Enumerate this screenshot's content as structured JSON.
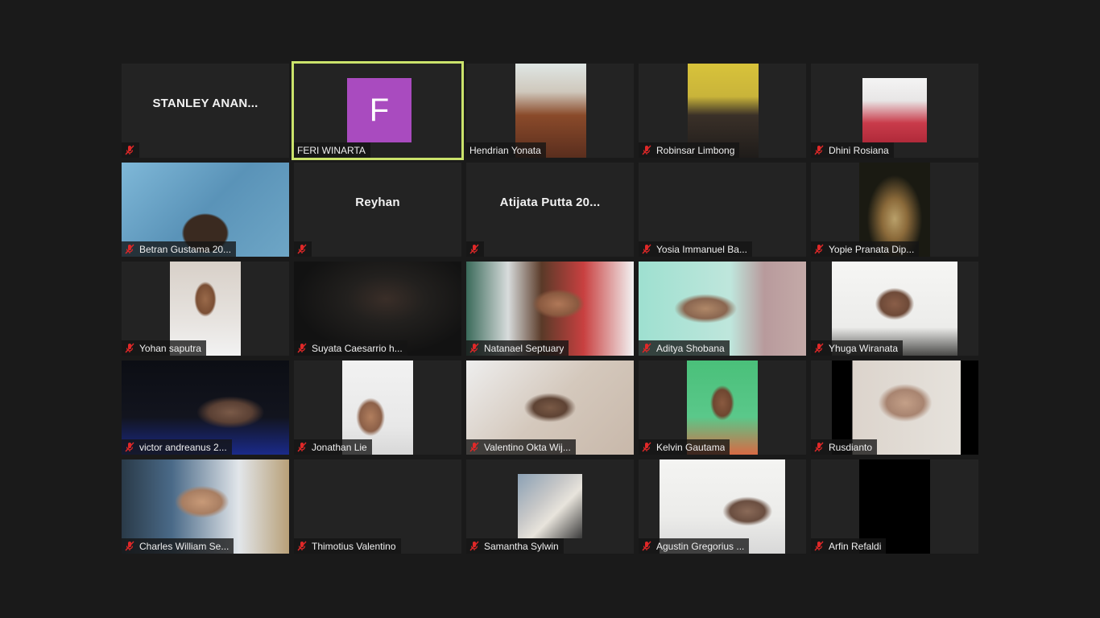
{
  "app": {
    "view": "gallery"
  },
  "participants": [
    {
      "name": "STANLEY ANAN...",
      "label": "",
      "muted": true,
      "type": "name",
      "active": false
    },
    {
      "name": "FERI WINARTA",
      "label": "FERI WINARTA",
      "muted": false,
      "type": "avatar",
      "avatar_letter": "F",
      "avatar_color": "#a94bbf",
      "active": true
    },
    {
      "name": "Hendrian Yonata",
      "label": "Hendrian Yonata",
      "muted": false,
      "type": "video",
      "active": false
    },
    {
      "name": "Robinsar Limbong",
      "label": "Robinsar Limbong",
      "muted": true,
      "type": "video",
      "active": false
    },
    {
      "name": "Dhini Rosiana",
      "label": "Dhini Rosiana",
      "muted": true,
      "type": "video",
      "active": false
    },
    {
      "name": "Betran Gustama 20...",
      "label": "Betran Gustama 20...",
      "muted": true,
      "type": "video",
      "active": false
    },
    {
      "name": "Reyhan",
      "label": "",
      "muted": true,
      "type": "name",
      "active": false
    },
    {
      "name": "Atijata Putta 20...",
      "label": "",
      "muted": true,
      "type": "name",
      "active": false
    },
    {
      "name": "Yosia Immanuel Ba...",
      "label": "Yosia Immanuel Ba...",
      "muted": true,
      "type": "blank",
      "active": false
    },
    {
      "name": "Yopie Pranata Dip...",
      "label": "Yopie Pranata Dip...",
      "muted": true,
      "type": "video",
      "active": false
    },
    {
      "name": "Yohan saputra",
      "label": "Yohan saputra",
      "muted": true,
      "type": "video",
      "active": false
    },
    {
      "name": "Suyata Caesarrio h...",
      "label": "Suyata Caesarrio h...",
      "muted": true,
      "type": "video",
      "active": false
    },
    {
      "name": "Natanael Septuary",
      "label": "Natanael Septuary",
      "muted": true,
      "type": "video",
      "active": false
    },
    {
      "name": "Aditya Shobana",
      "label": "Aditya Shobana",
      "muted": true,
      "type": "video",
      "active": false
    },
    {
      "name": "Yhuga Wiranata",
      "label": "Yhuga Wiranata",
      "muted": true,
      "type": "video",
      "active": false
    },
    {
      "name": "victor andreanus 2...",
      "label": "victor andreanus 2...",
      "muted": true,
      "type": "video",
      "active": false
    },
    {
      "name": "Jonathan Lie",
      "label": "Jonathan Lie",
      "muted": true,
      "type": "video",
      "active": false
    },
    {
      "name": "Valentino Okta Wij...",
      "label": "Valentino Okta Wij...",
      "muted": true,
      "type": "video",
      "active": false
    },
    {
      "name": "Kelvin Gautama",
      "label": "Kelvin Gautama",
      "muted": true,
      "type": "video",
      "active": false
    },
    {
      "name": "Rusdianto",
      "label": "Rusdianto",
      "muted": true,
      "type": "video",
      "active": false
    },
    {
      "name": "Charles William Se...",
      "label": "Charles William Se...",
      "muted": true,
      "type": "video",
      "active": false
    },
    {
      "name": "Thimotius Valentino",
      "label": "Thimotius Valentino",
      "muted": true,
      "type": "blank",
      "active": false
    },
    {
      "name": "Samantha Sylwin",
      "label": "Samantha Sylwin",
      "muted": true,
      "type": "video",
      "active": false
    },
    {
      "name": "Agustin Gregorius ...",
      "label": "Agustin Gregorius ...",
      "muted": true,
      "type": "video",
      "active": false
    },
    {
      "name": "Arfin Refaldi",
      "label": "Arfin Refaldi",
      "muted": true,
      "type": "video",
      "active": false
    }
  ],
  "icons": {
    "muted_mic": "mic-muted-icon"
  },
  "colors": {
    "background": "#1a1a1a",
    "tile": "#232323",
    "active_speaker_border": "#cbe36b",
    "muted_icon": "#e02828"
  }
}
